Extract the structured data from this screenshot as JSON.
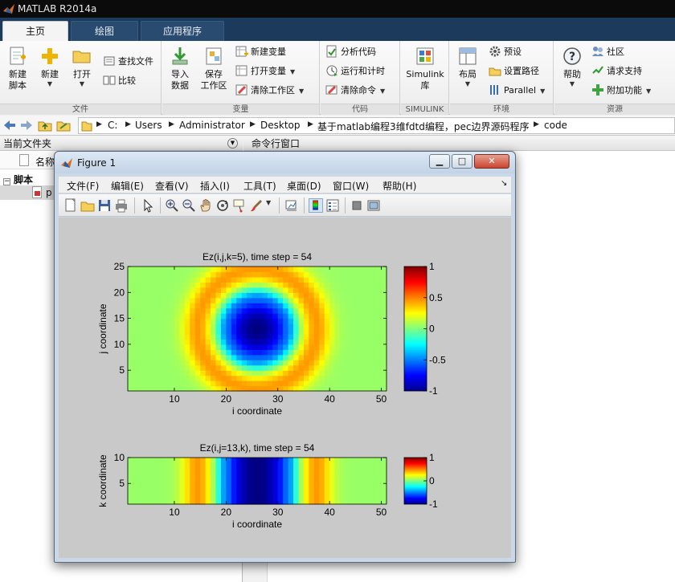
{
  "window": {
    "title": "MATLAB R2014a"
  },
  "tabs": [
    {
      "label": "主页"
    },
    {
      "label": "绘图"
    },
    {
      "label": "应用程序"
    }
  ],
  "ribbon": {
    "file": {
      "label": "文件",
      "new_script": "新建\n脚本",
      "new": "新建",
      "open": "打开",
      "find_files": "查找文件",
      "compare": "比较"
    },
    "variable": {
      "label": "变量",
      "import": "导入\n数据",
      "save_ws": "保存\n工作区",
      "new_var": "新建变量",
      "open_var": "打开变量",
      "clear_ws": "清除工作区"
    },
    "code": {
      "label": "代码",
      "analyze": "分析代码",
      "run_time": "运行和计时",
      "clear_cmd": "清除命令"
    },
    "simulink": {
      "label": "SIMULINK",
      "lib": "Simulink\n库"
    },
    "env": {
      "label": "环境",
      "layout": "布局",
      "prefs": "预设",
      "set_path": "设置路径",
      "parallel": "Parallel"
    },
    "resources": {
      "label": "资源",
      "help": "帮助",
      "community": "社区",
      "support": "请求支持",
      "addons": "附加功能"
    }
  },
  "path": [
    "C:",
    "Users",
    "Administrator",
    "Desktop",
    "基于matlab编程3维fdtd编程，pec边界源码程序",
    "code"
  ],
  "left_panel": {
    "title": "当前文件夹",
    "column_name": "名称",
    "group": "脚本",
    "file": "p"
  },
  "right_panel": {
    "title": "命令行窗口"
  },
  "figure": {
    "title": "Figure 1",
    "menu": [
      "文件(F)",
      "编辑(E)",
      "查看(V)",
      "插入(I)",
      "工具(T)",
      "桌面(D)",
      "窗口(W)",
      "帮助(H)"
    ]
  },
  "chart_data": [
    {
      "type": "heatmap",
      "title": "Ez(i,j,k=5), time step = 54",
      "xlabel": "i coordinate",
      "ylabel": "j coordinate",
      "xlim": [
        1,
        51
      ],
      "ylim": [
        1,
        25
      ],
      "xticks": [
        10,
        20,
        30,
        40,
        50
      ],
      "yticks": [
        5,
        10,
        15,
        20,
        25
      ],
      "colormap": "jet",
      "clim": [
        -1,
        1
      ],
      "colorbar_ticks": [
        1,
        0.5,
        0,
        -0.5,
        -1
      ],
      "field": {
        "center_i": 26,
        "center_j": 13,
        "center_value": -1,
        "background_value": 0.05,
        "ring_value": 0.4,
        "core_radius": 5.5,
        "ring_radius": 11.5,
        "ring_width": 3.0
      }
    },
    {
      "type": "heatmap",
      "title": "Ez(i,j=13,k), time step = 54",
      "xlabel": "i coordinate",
      "ylabel": "k coordinate",
      "xlim": [
        1,
        51
      ],
      "ylim": [
        1,
        10
      ],
      "xticks": [
        10,
        20,
        30,
        40,
        50
      ],
      "yticks": [
        5,
        10
      ],
      "colormap": "jet",
      "clim": [
        -1,
        1
      ],
      "colorbar_ticks": [
        1,
        0,
        -1
      ],
      "profile": {
        "center_i": 26,
        "center_value": -1,
        "background_value": 0.05,
        "ring_value": 0.4,
        "core_radius": 5.5,
        "ring_radius": 11.5,
        "ring_width": 3.0
      }
    }
  ]
}
